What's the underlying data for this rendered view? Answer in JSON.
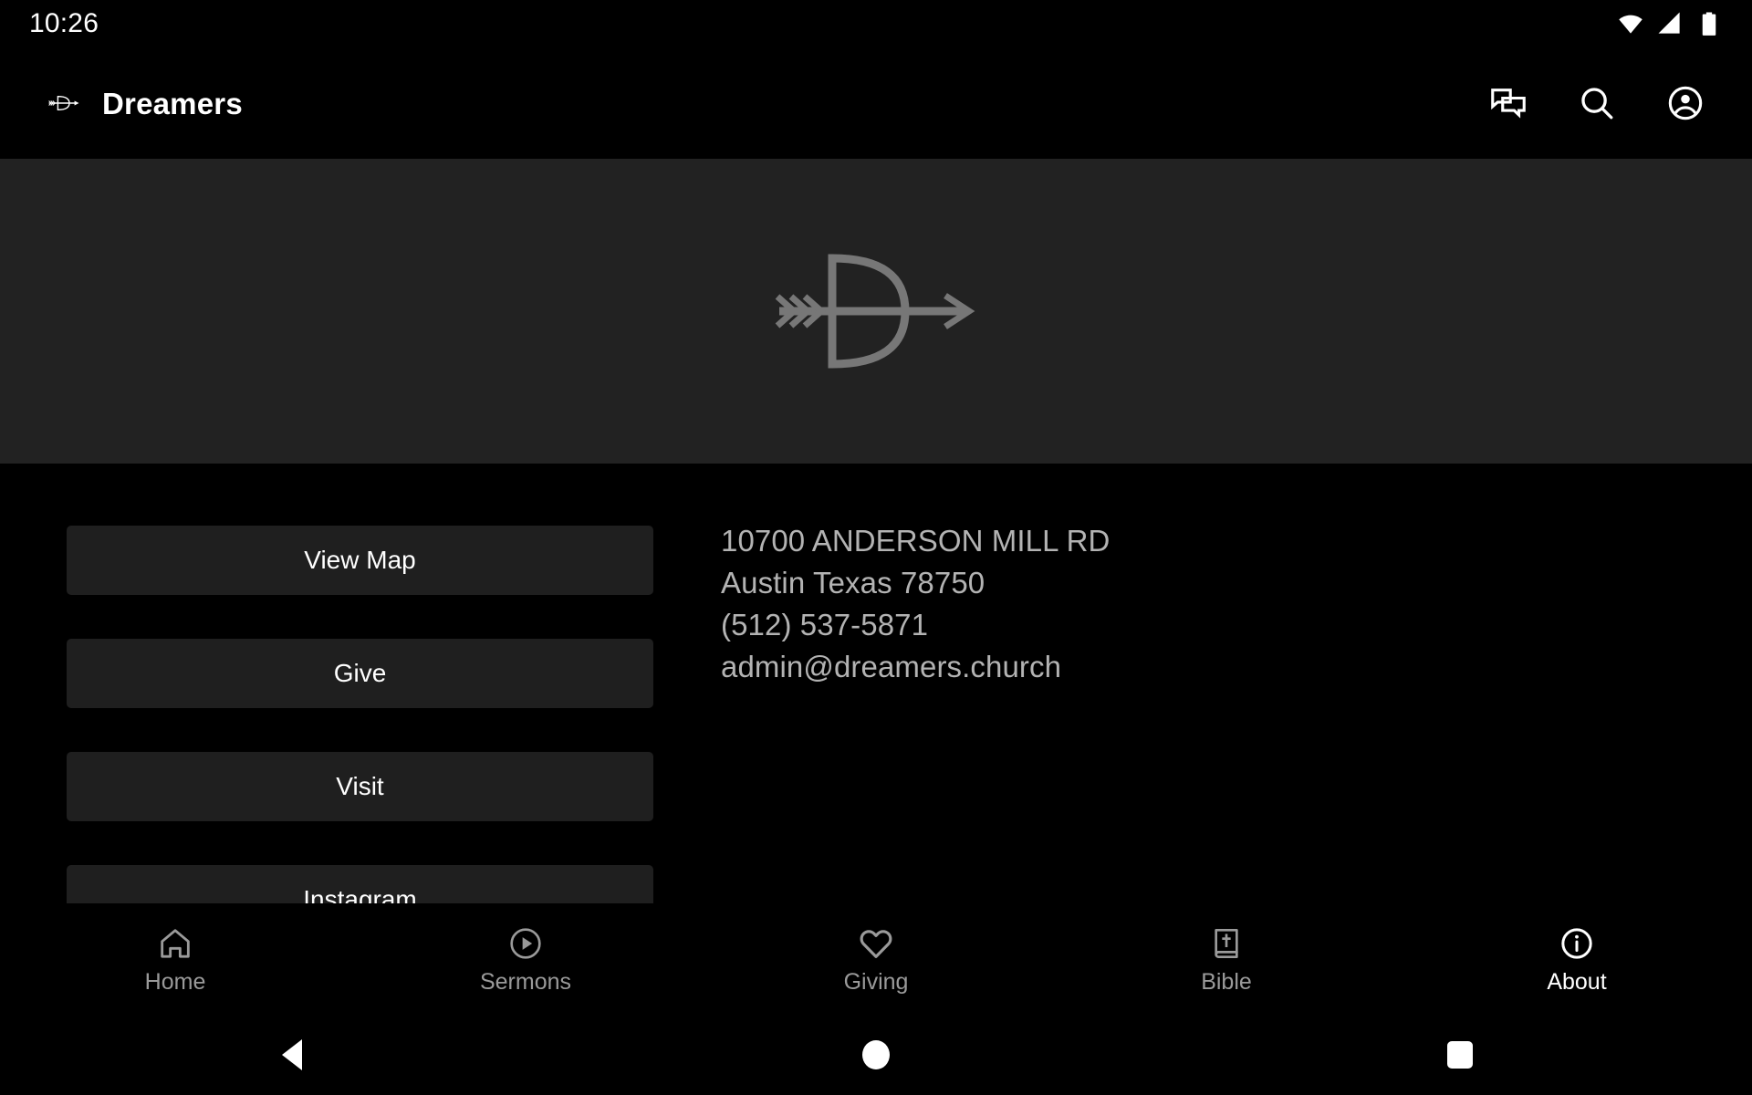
{
  "status_bar": {
    "clock": "10:26",
    "icons": [
      "wifi-icon",
      "cellular-signal-icon",
      "battery-icon"
    ]
  },
  "app_bar": {
    "logo_icon": "dreamers-arrow-d-logo",
    "title": "Dreamers",
    "actions": [
      {
        "name": "messages-icon",
        "label": "Messages"
      },
      {
        "name": "search-icon",
        "label": "Search"
      },
      {
        "name": "account-circle-icon",
        "label": "Account"
      }
    ]
  },
  "hero": {
    "logo_icon": "dreamers-arrow-d-logo-large",
    "background_color": "#222222",
    "logo_color": "#777777"
  },
  "main": {
    "buttons": [
      {
        "label": "View Map",
        "name": "view-map-button"
      },
      {
        "label": "Give",
        "name": "give-button"
      },
      {
        "label": "Visit",
        "name": "visit-button"
      },
      {
        "label": "Instagram",
        "name": "instagram-button"
      }
    ],
    "contact": {
      "street": "10700 ANDERSON MILL RD",
      "city_state_zip": "Austin Texas 78750",
      "phone": "(512) 537-5871",
      "email": "admin@dreamers.church"
    }
  },
  "tab_bar": {
    "active": "About",
    "tabs": [
      {
        "label": "Home",
        "icon": "home-icon",
        "active": false
      },
      {
        "label": "Sermons",
        "icon": "play-circle-icon",
        "active": false
      },
      {
        "label": "Giving",
        "icon": "heart-icon",
        "active": false
      },
      {
        "label": "Bible",
        "icon": "bible-book-icon",
        "active": false
      },
      {
        "label": "About",
        "icon": "info-circle-icon",
        "active": true
      }
    ],
    "inactive_color": "#9a9a9a",
    "active_color": "#ffffff"
  },
  "system_nav": {
    "buttons": [
      {
        "name": "android-back-button",
        "label": "Back"
      },
      {
        "name": "android-home-button",
        "label": "Home"
      },
      {
        "name": "android-recents-button",
        "label": "Recents"
      }
    ]
  }
}
